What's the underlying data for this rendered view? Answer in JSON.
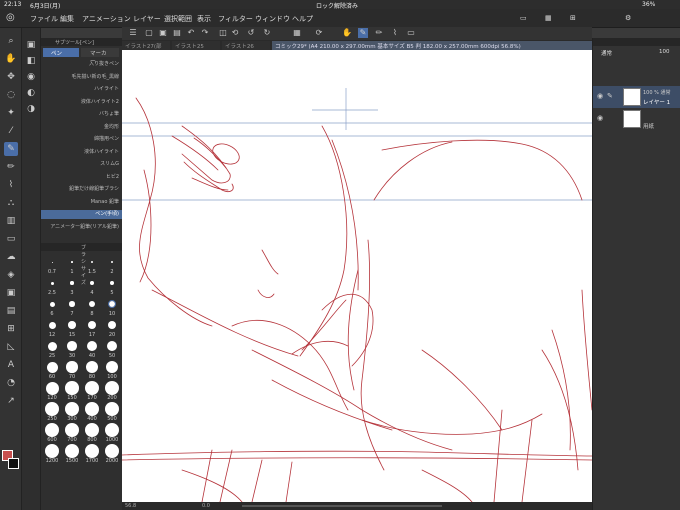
{
  "status": {
    "time": "22:13",
    "date": "6月3日(月)",
    "lock": "ロック解除済み",
    "battery": "36%"
  },
  "menu": [
    "ファイル",
    "編集",
    "アニメーション",
    "レイヤー",
    "選択範囲",
    "表示",
    "フィルター",
    "ウィンドウ",
    "ヘルプ"
  ],
  "tabs": [
    {
      "label": "イラスト27(部"
    },
    {
      "label": "イラスト25"
    },
    {
      "label": "イラスト26"
    },
    {
      "label": "コミック29* (A4 210.00 x 297.00mm 基本サイズ B5 判 182.00 x 257.00mm 600dpi 56.8%)"
    }
  ],
  "subtool": {
    "title": "サブツール[ペン]",
    "tab_pen": "ペン",
    "tab_marker": "マーカー"
  },
  "brushes": [
    "入り抜きペン",
    "毛先揃い新の毛_黒線",
    "ハイライト",
    "液体ハイライト2",
    "バちょ筆",
    "金均形",
    "綿描用ペン",
    "液体ハイライト",
    "スリムG",
    "ヒビ2",
    "鉛筆だけ線鉛筆ブラシ",
    "Manao 鉛筆",
    "ペン(手頃)",
    "アニメーター鉛筆(リアル鉛筆)"
  ],
  "brushsize": {
    "title": "ブラシサイズ",
    "sizes": [
      "0.7",
      "1",
      "1.5",
      "2",
      "2.5",
      "3",
      "4",
      "5",
      "6",
      "7",
      "8",
      "10",
      "12",
      "15",
      "17",
      "20",
      "25",
      "30",
      "40",
      "50",
      "60",
      "70",
      "80",
      "100",
      "120",
      "150",
      "170",
      "200",
      "250",
      "300",
      "400",
      "500",
      "600",
      "700",
      "800",
      "1000",
      "1200",
      "1500",
      "1700",
      "2000"
    ],
    "selected": "10"
  },
  "layers": {
    "blend": "通常",
    "opacity": "100",
    "items": [
      {
        "name": "レイヤー 1",
        "info": "100 % 通常"
      },
      {
        "name": "用紙"
      }
    ]
  },
  "bottom": {
    "zoom": "56.8",
    "angle": "0.0"
  },
  "colors": {
    "main": "#c8504f",
    "sub": "#111111",
    "accent": "#4a6ea8",
    "line": "#b5333a",
    "guide": "#8aa0c8"
  }
}
